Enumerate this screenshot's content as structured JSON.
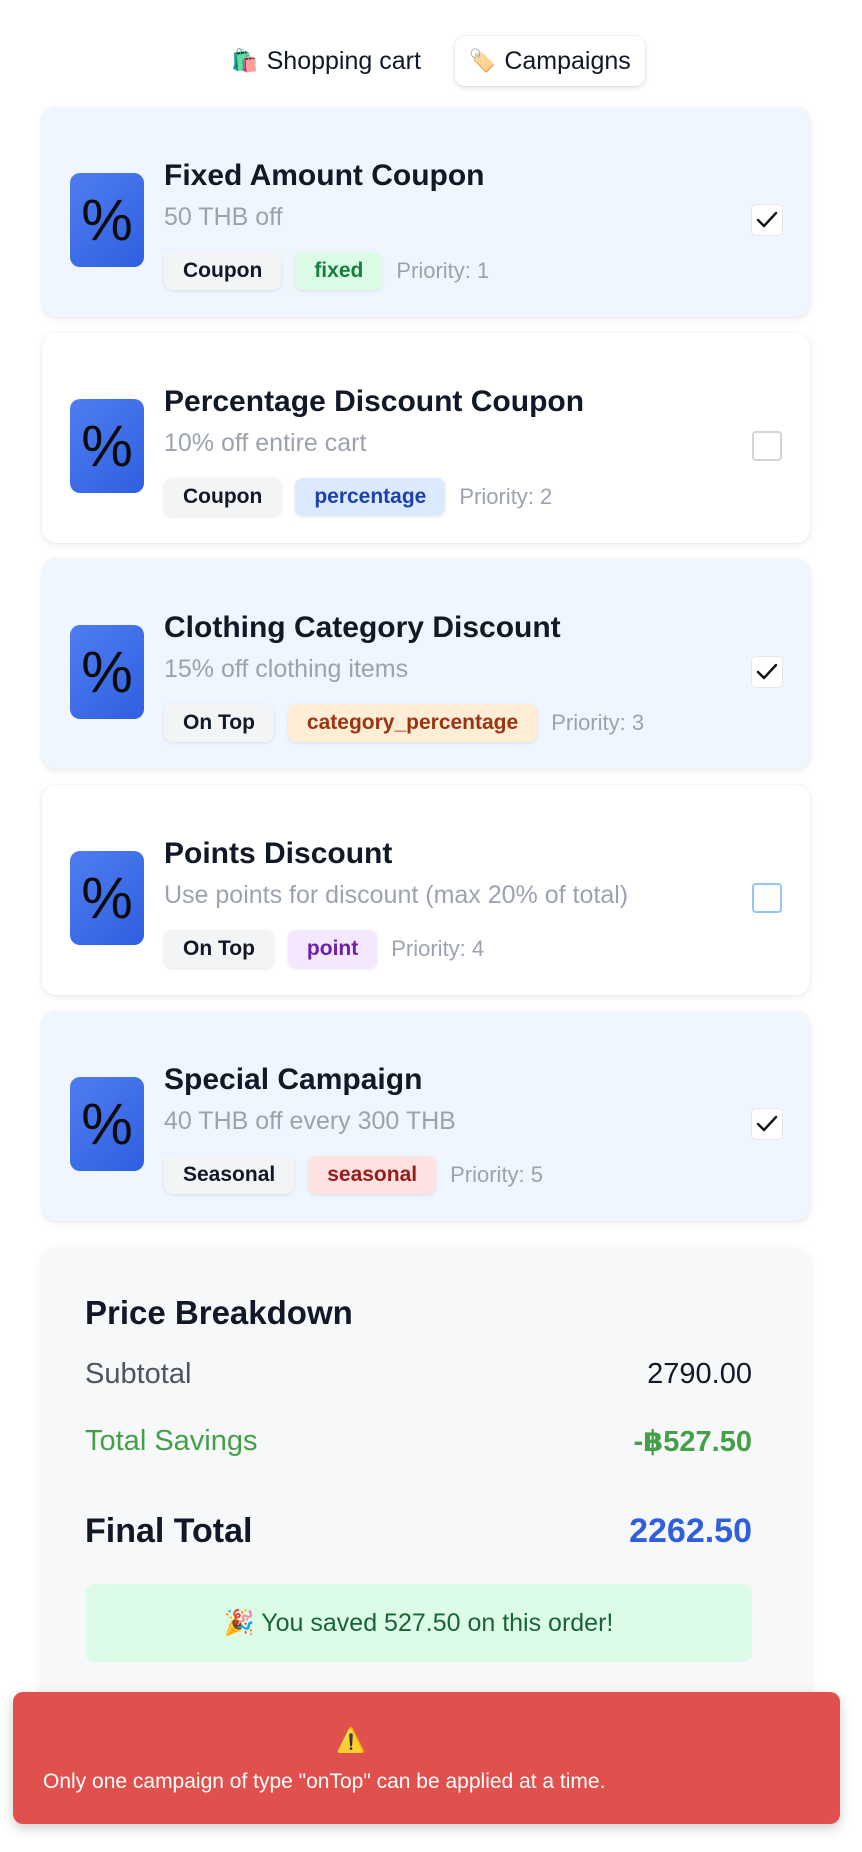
{
  "tabs": [
    {
      "icon": "🛍️",
      "icon_name": "shopping-bag-icon",
      "label": "Shopping cart",
      "active": false
    },
    {
      "icon": "🏷️",
      "icon_name": "tag-icon",
      "label": "Campaigns",
      "active": true
    }
  ],
  "campaigns": [
    {
      "icon": "%",
      "title": "Fixed Amount Coupon",
      "description": "50 THB off",
      "category": "Coupon",
      "type": "fixed",
      "priority": "Priority: 1",
      "selected": true
    },
    {
      "icon": "%",
      "title": "Percentage Discount Coupon",
      "description": "10% off entire cart",
      "category": "Coupon",
      "type": "percentage",
      "priority": "Priority: 2",
      "selected": false
    },
    {
      "icon": "%",
      "title": "Clothing Category Discount",
      "description": "15% off clothing items",
      "category": "On Top",
      "type": "category_percentage",
      "priority": "Priority: 3",
      "selected": true
    },
    {
      "icon": "%",
      "title": "Points Discount",
      "description": "Use points for discount (max 20% of total)",
      "category": "On Top",
      "type": "point",
      "priority": "Priority: 4",
      "selected": false
    },
    {
      "icon": "%",
      "title": "Special Campaign",
      "description": "40 THB off every 300 THB",
      "category": "Seasonal",
      "type": "seasonal",
      "priority": "Priority: 5",
      "selected": true
    }
  ],
  "breakdown": {
    "title": "Price Breakdown",
    "subtotal_label": "Subtotal",
    "subtotal_value": "2790.00",
    "savings_label": "Total Savings",
    "savings_value": "-฿527.50",
    "final_label": "Final Total",
    "final_value": "2262.50",
    "saved_message": "🎉 You saved 527.50 on this order!"
  },
  "toast": {
    "icon": "⚠️",
    "icon_name": "warning-icon",
    "message": "Only one campaign of type \"onTop\" can be applied at a time."
  },
  "colors": {
    "accent": "#2f5fdb",
    "selected_card_bg": "#eff6ff",
    "savings_green": "#43a047",
    "error_red": "#e0504c"
  }
}
